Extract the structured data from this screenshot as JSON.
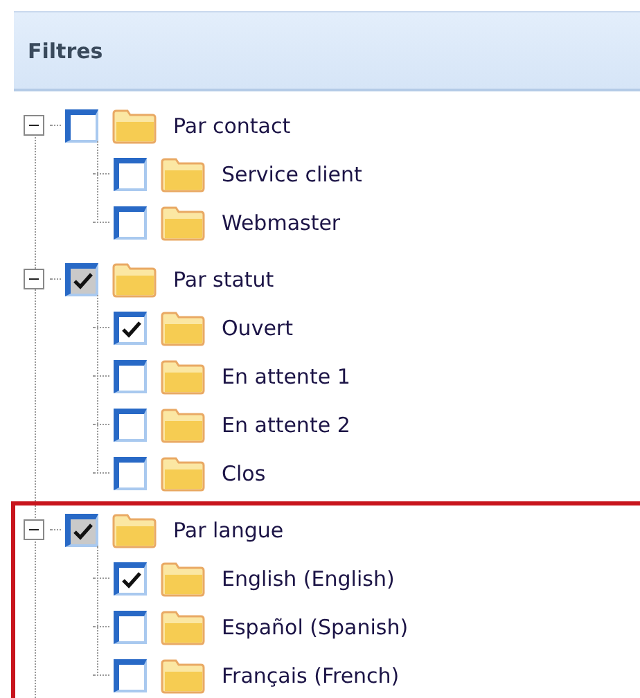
{
  "panel": {
    "title": "Filtres"
  },
  "groups": [
    {
      "label": "Par contact",
      "expanded": true,
      "checked": false,
      "highlighted": false,
      "children": [
        {
          "label": "Service client",
          "checked": false
        },
        {
          "label": "Webmaster",
          "checked": false
        }
      ]
    },
    {
      "label": "Par statut",
      "expanded": true,
      "checked": true,
      "highlighted": false,
      "children": [
        {
          "label": "Ouvert",
          "checked": true
        },
        {
          "label": "En attente 1",
          "checked": false
        },
        {
          "label": "En attente 2",
          "checked": false
        },
        {
          "label": "Clos",
          "checked": false
        }
      ]
    },
    {
      "label": "Par langue",
      "expanded": true,
      "checked": true,
      "highlighted": true,
      "children": [
        {
          "label": "English (English)",
          "checked": true
        },
        {
          "label": "Español (Spanish)",
          "checked": false
        },
        {
          "label": "Français (French)",
          "checked": false
        }
      ]
    }
  ]
}
